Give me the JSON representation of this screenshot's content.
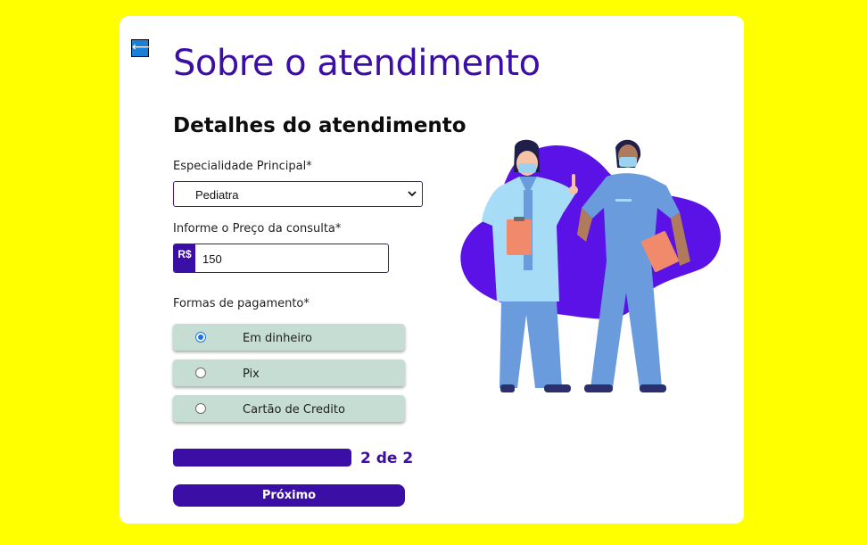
{
  "page": {
    "back_icon": "arrow-left-icon",
    "back_glyph": "⟵",
    "title": "Sobre o atendimento",
    "section_title": "Detalhes do atendimento"
  },
  "form": {
    "specialty_label": "Especialidade Principal*",
    "specialty_value": "Pediatra",
    "price_label": "Informe o Preço da consulta*",
    "currency": "R$",
    "price_value": "150",
    "payment_label": "Formas de pagamento*",
    "payment_options": [
      {
        "label": "Em dinheiro",
        "selected": true
      },
      {
        "label": "Pix",
        "selected": false
      },
      {
        "label": "Cartão de Credito",
        "selected": false
      }
    ]
  },
  "progress": {
    "text": "2 de 2",
    "fraction": 1.0
  },
  "next_button": "Próximo",
  "colors": {
    "background": "#ffff00",
    "accent": "#3b0ea5",
    "option_bg": "#c6ddd4",
    "illustration_blob": "#5b12e6"
  },
  "illustration": {
    "icon": "doctors-illustration-icon"
  }
}
